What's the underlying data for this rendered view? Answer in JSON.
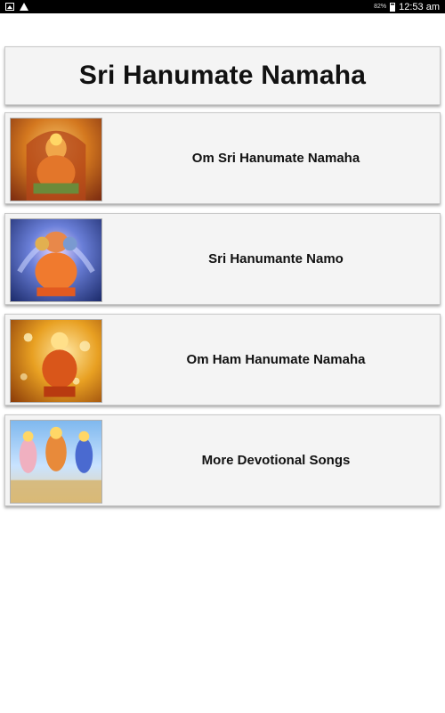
{
  "status_bar": {
    "icons_left": [
      "image-notification-icon",
      "warning-icon"
    ],
    "battery_percent": "82%",
    "time": "12:53 am"
  },
  "header": {
    "title": "Sri Hanumate Namaha"
  },
  "items": [
    {
      "label": "Om Sri Hanumate Namaha",
      "thumbnail_icon": "hanuman-seated-icon"
    },
    {
      "label": "Sri Hanumante Namo",
      "thumbnail_icon": "panchamukhi-hanuman-icon"
    },
    {
      "label": "Om Ham Hanumate Namaha",
      "thumbnail_icon": "hanuman-golden-icon"
    },
    {
      "label": "More Devotional Songs",
      "thumbnail_icon": "deities-group-icon"
    }
  ],
  "colors": {
    "status_bar_bg": "#000000",
    "card_bg": "#f4f4f4",
    "page_bg": "#ffffff",
    "text": "#111111"
  }
}
